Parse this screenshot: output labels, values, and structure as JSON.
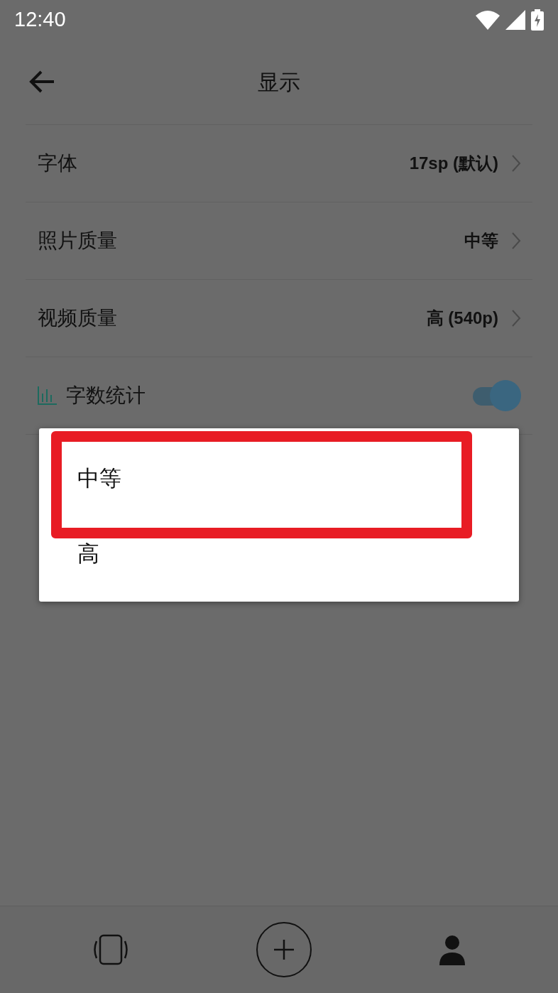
{
  "status_bar": {
    "time": "12:40"
  },
  "toolbar": {
    "title": "显示"
  },
  "settings": [
    {
      "kind": "value",
      "label": "字体",
      "value": "17sp (默认)"
    },
    {
      "kind": "value",
      "label": "照片质量",
      "value": "中等"
    },
    {
      "kind": "value",
      "label": "视频质量",
      "value": "高 (540p)"
    },
    {
      "kind": "toggle",
      "label": "字数统计",
      "on": true
    }
  ],
  "popup": {
    "items": [
      {
        "label": "中等",
        "highlighted": true
      },
      {
        "label": "高",
        "highlighted": false
      }
    ]
  }
}
